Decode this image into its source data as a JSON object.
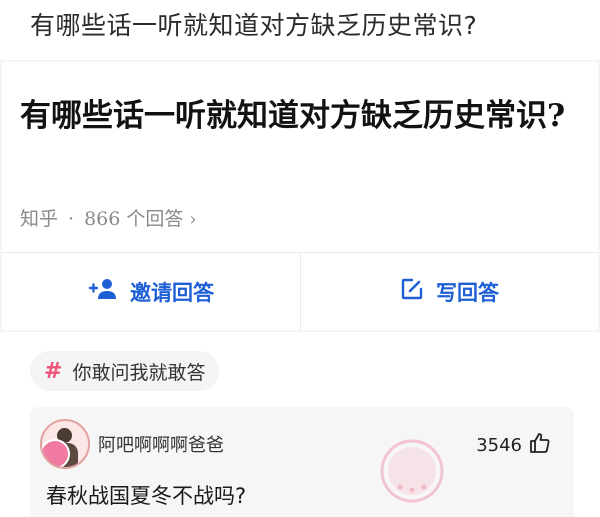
{
  "post": {
    "title": "有哪些话一听就知道对方缺乏历史常识?"
  },
  "question": {
    "title": "有哪些话一听就知道对方缺乏历史常识?",
    "source": "知乎",
    "separator": "·",
    "answers": "866 个回答",
    "chevron": "›"
  },
  "actions": {
    "invite_label": "邀请回答",
    "write_label": "写回答"
  },
  "topic": {
    "hash": "#",
    "label": "你敢问我就敢答"
  },
  "comment": {
    "username": "阿吧啊啊啊爸爸",
    "likes": "3546",
    "text": "春秋战国夏冬不战吗?"
  },
  "icons": {
    "invite": "add-person-icon",
    "write": "edit-icon",
    "like": "thumbs-up-icon",
    "stamp": "shenping-stamp-icon"
  },
  "colors": {
    "accent": "#1f5fd6",
    "topic_hash": "#f0527a"
  }
}
